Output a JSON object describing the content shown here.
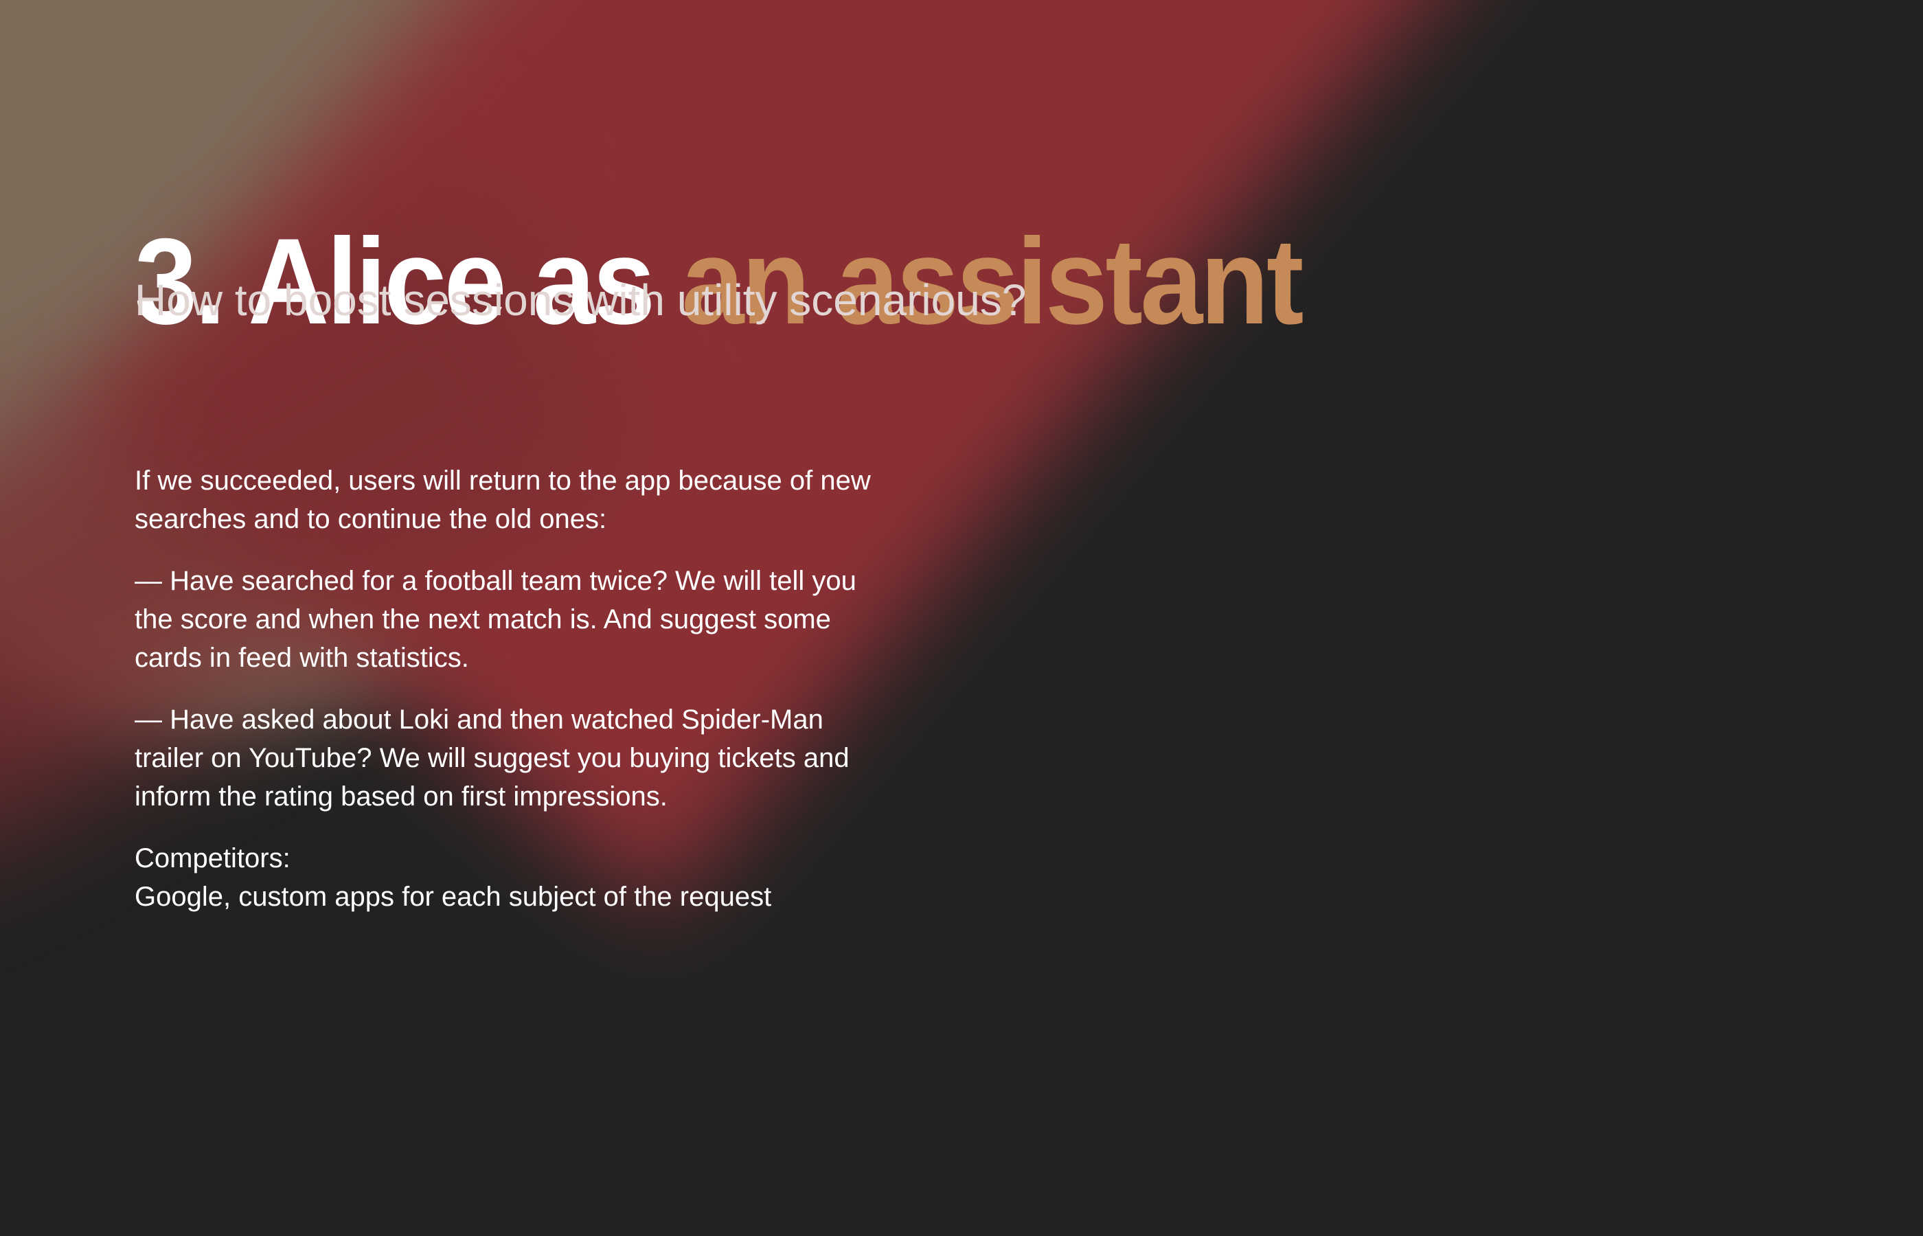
{
  "title": {
    "number_prefix": "3. Alice as ",
    "accent": "an assistant"
  },
  "subtitle": "How to boost sessions with utility scenarious?",
  "paragraphs": [
    "If we succeeded, users will return to the app because of new searches and to continue the old ones:",
    "— Have searched for a football team twice? We will tell you the score and when the next match is.  And suggest some cards in feed with statistics.",
    "— Have asked about Loki and then watched Spider-Man trailer on YouTube? We will suggest you buying tickets and inform the rating based on first impressions."
  ],
  "competitors": {
    "label": "Competitors:",
    "value": "Google, custom apps for each subject of the request"
  },
  "colors": {
    "background": "#222222",
    "accent": "#c68a58",
    "red": "#8a3035",
    "tan": "#7d6b5a"
  }
}
